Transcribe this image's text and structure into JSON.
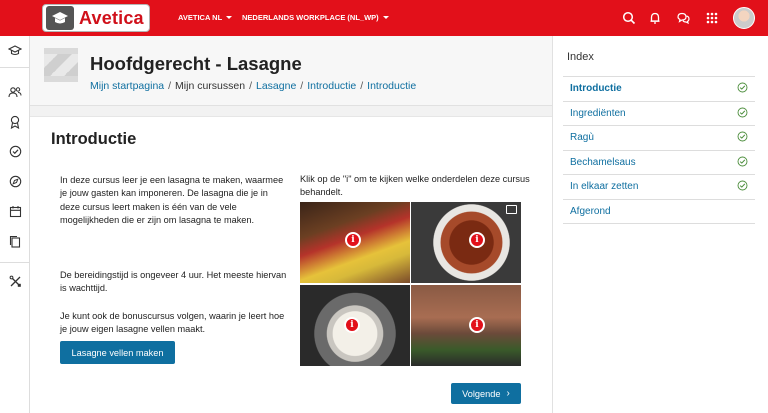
{
  "topbar": {
    "logo_text": "Avetica",
    "menu": [
      {
        "label": "AVETICA NL"
      },
      {
        "label": "NEDERLANDS WORKPLACE (NL_WP)"
      }
    ],
    "icons": [
      "search-icon",
      "bell-icon",
      "chat-icon",
      "apps-grid-icon",
      "user-avatar"
    ]
  },
  "sidebar": {
    "icons": [
      "graduation-cap-icon",
      "users-icon",
      "award-icon",
      "check-circle-icon",
      "compass-icon",
      "calendar-icon",
      "copy-icon",
      "tools-icon"
    ]
  },
  "header": {
    "title": "Hoofdgerecht - Lasagne",
    "breadcrumb": [
      "Mijn startpagina",
      "Mijn cursussen",
      "Lasagne",
      "Introductie",
      "Introductie"
    ]
  },
  "content": {
    "heading": "Introductie",
    "paragraphs": [
      "In deze cursus leer je een lasagna te maken, waarmee je jouw gasten kan imponeren. De lasagna die je in deze cursus leert maken is één van de vele mogelijkheden die er zijn om lasagna te maken.",
      "De bereidingstijd is ongeveer 4 uur. Het meeste hiervan is wachttijd.",
      "Je kunt ook de bonuscursus volgen, waarin je leert hoe je jouw eigen lasagne vellen maakt."
    ],
    "bonus_button": "Lasagne vellen maken",
    "right_text": "Klik op de \"i\" om te kijken welke onderdelen deze cursus behandelt.",
    "info_glyph": "i",
    "next_button": "Volgende"
  },
  "colors": {
    "brand": "#e2101a",
    "link": "#0f6fa0",
    "check": "#4a8c3a"
  },
  "index": {
    "title": "Index",
    "items": [
      {
        "label": "Introductie",
        "active": true,
        "done": true
      },
      {
        "label": "Ingrediënten",
        "active": false,
        "done": true
      },
      {
        "label": "Ragù",
        "active": false,
        "done": true
      },
      {
        "label": "Bechamelsaus",
        "active": false,
        "done": true
      },
      {
        "label": "In elkaar zetten",
        "active": false,
        "done": true
      },
      {
        "label": "Afgerond",
        "active": false,
        "done": false
      }
    ]
  }
}
